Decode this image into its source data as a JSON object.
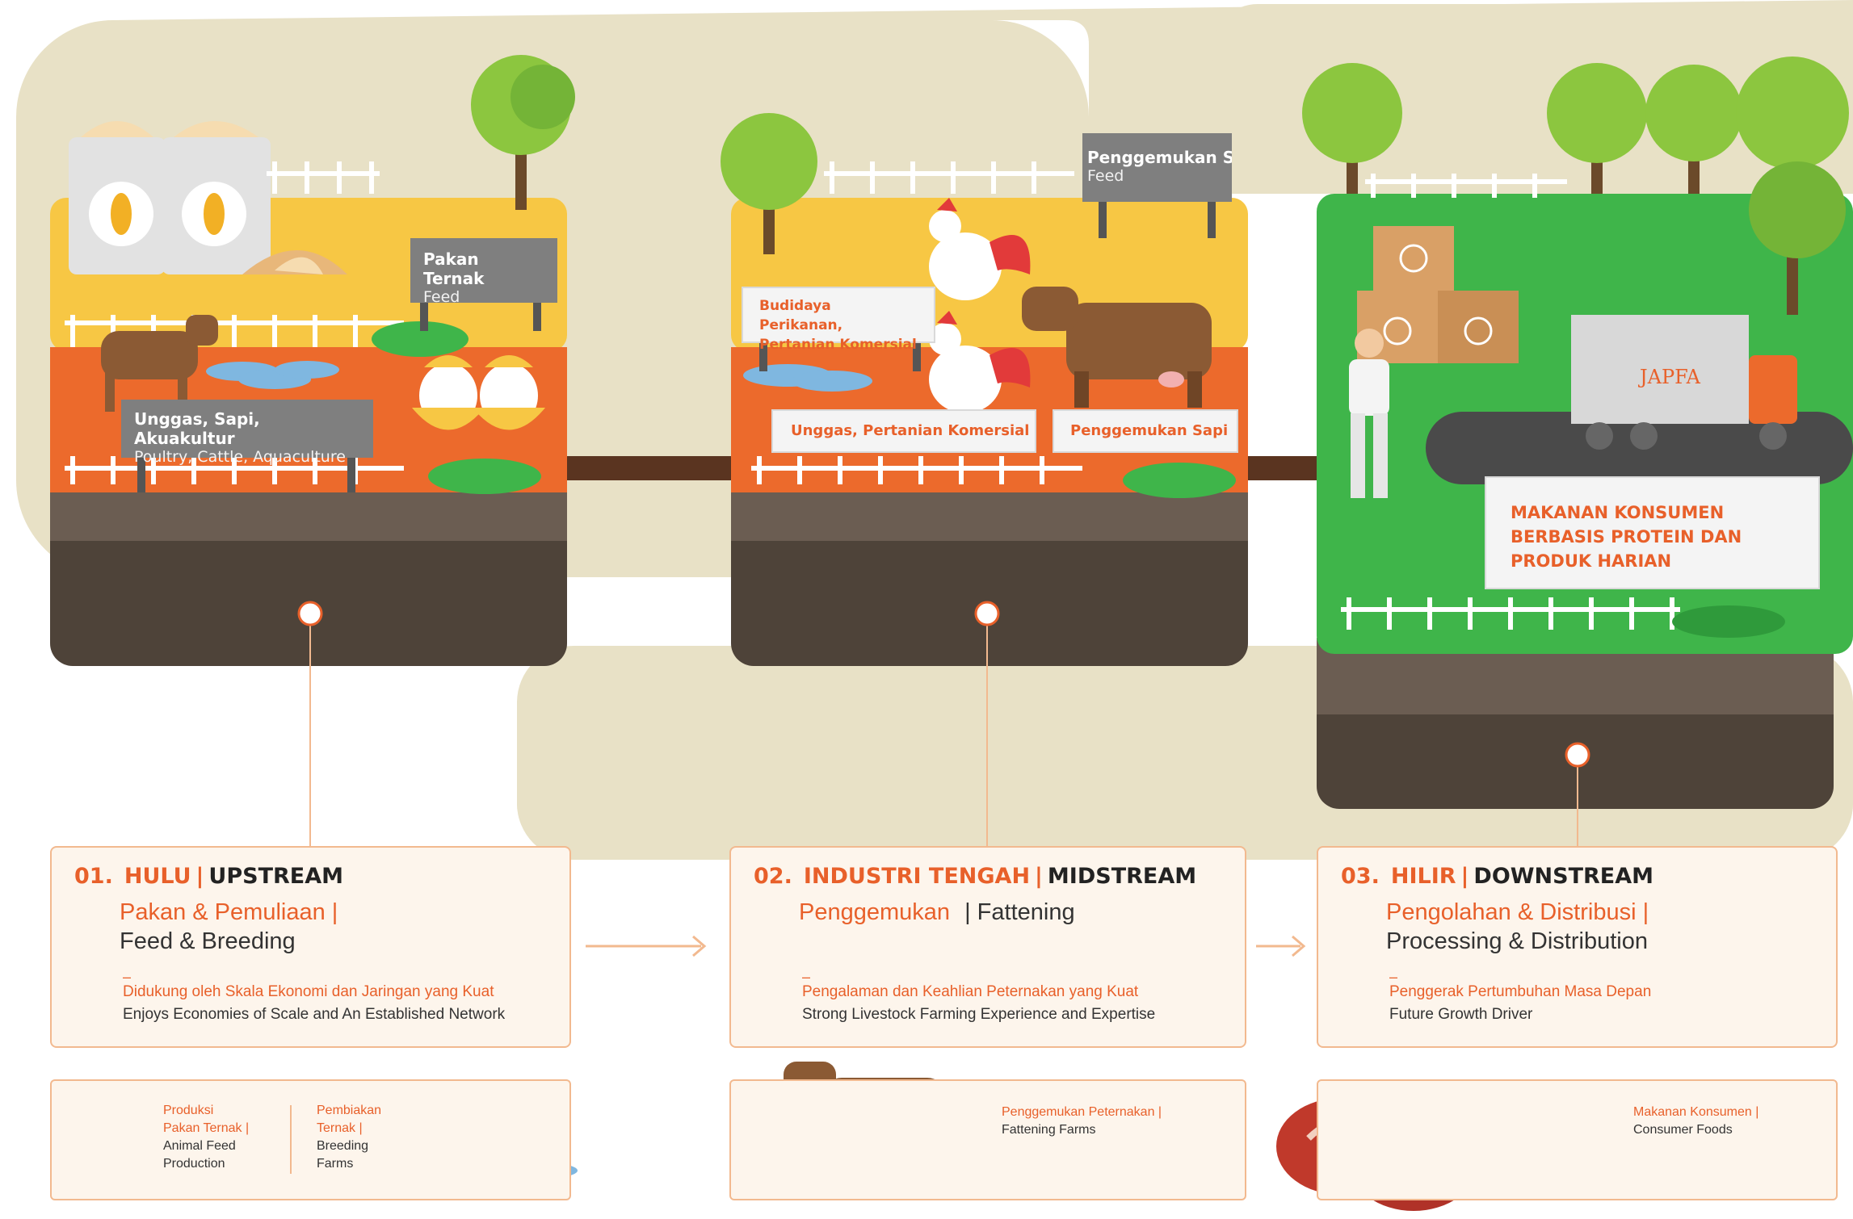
{
  "stages": [
    {
      "num": "01.",
      "id": "HULU",
      "en": "UPSTREAM",
      "sub_id": "Pakan & Pemuliaan |",
      "sub_en": "Feed & Breeding",
      "dash": "–",
      "desc_id": "Didukung oleh Skala Ekonomi dan Jaringan yang Kuat",
      "desc_en": "Enjoys Economies of Scale and An Established Network"
    },
    {
      "num": "02.",
      "id": "INDUSTRI TENGAH",
      "en": "MIDSTREAM",
      "sub_id": "Penggemukan",
      "sub_en": "| Fattening",
      "dash": "–",
      "desc_id": "Pengalaman dan Keahlian Peternakan yang Kuat",
      "desc_en": "Strong Livestock Farming Experience and Expertise"
    },
    {
      "num": "03.",
      "id": "HILIR",
      "en": "DOWNSTREAM",
      "sub_id": "Pengolahan & Distribusi |",
      "sub_en": "Processing & Distribution",
      "dash": "–",
      "desc_id": "Penggerak Pertumbuhan Masa Depan",
      "desc_en": "Future Growth Driver"
    }
  ],
  "separator": "|",
  "signs": {
    "pakan_ternak": {
      "t1": "Pakan Ternak",
      "t2": "Feed"
    },
    "unggas_sapi": {
      "t1": "Unggas, Sapi, Akuakultur",
      "t2": "Poultry, Cattle, Aquaculture"
    },
    "penggemukan_sapi_feed": {
      "t1": "Penggemukan Sapi",
      "t2": "Feed"
    },
    "budidaya": {
      "t1": "Budidaya Perikanan,",
      "t2": "Pertanian Komersial"
    },
    "unggas_pertanian": "Unggas, Pertanian Komersial",
    "penggemukan_sapi": "Penggemukan Sapi",
    "makanan": [
      "MAKANAN KONSUMEN",
      "BERBASIS PROTEIN DAN",
      "PRODUK HARIAN"
    ]
  },
  "truck_logo": "JAPFA",
  "mini": {
    "m1a": [
      "Produksi",
      "Pakan Ternak |"
    ],
    "m1a_en": [
      "Animal Feed",
      "Production"
    ],
    "m1b": [
      "Pembiakan",
      "Ternak |"
    ],
    "m1b_en": [
      "Breeding",
      "Farms"
    ],
    "m2": "Penggemukan Peternakan |",
    "m2_en": "Fattening Farms",
    "m3": "Makanan Konsumen |",
    "m3_en": "Consumer Foods"
  },
  "colors": {
    "accent": "#e8602a",
    "beige": "#e8e1c6",
    "yellow": "#f7c744",
    "orange": "#ec6a2c",
    "green": "#3fb54a",
    "soil": "#4e4339"
  }
}
